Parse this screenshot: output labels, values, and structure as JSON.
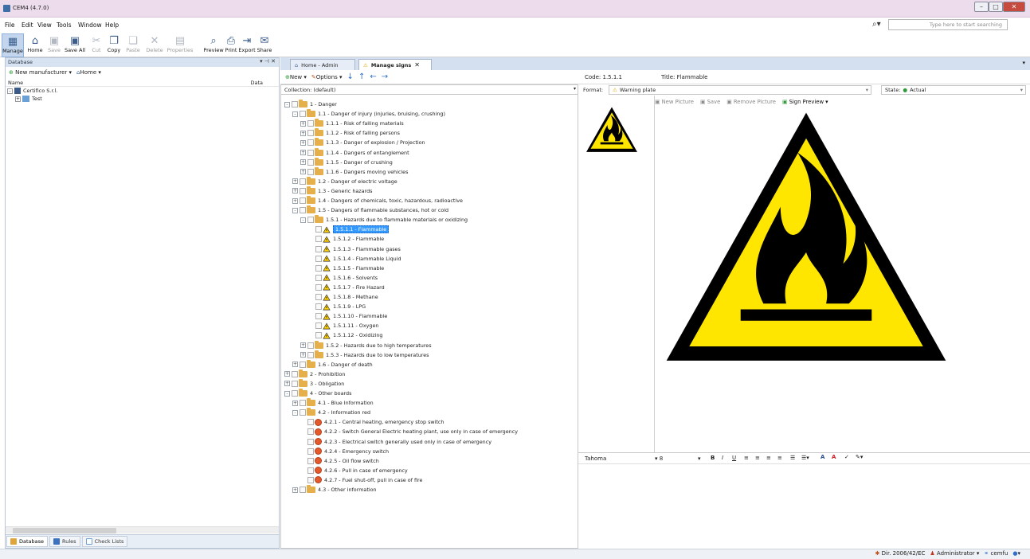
{
  "window": {
    "title": "CEM4 (4.7.0)"
  },
  "menu": [
    "File",
    "Edit",
    "View",
    "Tools",
    "Window",
    "Help"
  ],
  "search": {
    "placeholder": "Type here to start searching"
  },
  "toolbar": {
    "manage": "Manage",
    "home": "Home",
    "save": "Save",
    "save_all": "Save All",
    "cut": "Cut",
    "copy": "Copy",
    "paste": "Paste",
    "delete": "Delete",
    "properties": "Properties",
    "preview": "Preview",
    "print": "Print",
    "export": "Export",
    "share": "Share"
  },
  "left_panel": {
    "title": "Database",
    "new_manufacturer": "New manufacturer",
    "home": "Home",
    "col_name": "Name",
    "col_data": "Data",
    "tree": [
      "Certifico S.r.l.",
      "Test"
    ],
    "tabs": [
      "Database",
      "Rules",
      "Check Lists"
    ]
  },
  "tabs": [
    "Home - Admin",
    "Manage signs"
  ],
  "mid": {
    "new": "New",
    "options": "Options",
    "collection": "Collection: (default)",
    "tree": [
      {
        "label": "1 - Danger",
        "lvl": 0,
        "t": "folder",
        "pm": "-"
      },
      {
        "label": "1.1 - Danger of injury (injuries, bruising, crushing)",
        "lvl": 1,
        "t": "folder",
        "pm": "-"
      },
      {
        "label": "1.1.1 - Risk of falling materials",
        "lvl": 2,
        "t": "folder",
        "pm": "+"
      },
      {
        "label": "1.1.2 - Risk of falling persons",
        "lvl": 2,
        "t": "folder",
        "pm": "+"
      },
      {
        "label": "1.1.3 - Danger of explosion / Projection",
        "lvl": 2,
        "t": "folder",
        "pm": "+"
      },
      {
        "label": "1.1.4 - Dangers of entanglement",
        "lvl": 2,
        "t": "folder",
        "pm": "+"
      },
      {
        "label": "1.1.5 - Danger of crushing",
        "lvl": 2,
        "t": "folder",
        "pm": "+"
      },
      {
        "label": "1.1.6 - Dangers moving vehicles",
        "lvl": 2,
        "t": "folder",
        "pm": "+"
      },
      {
        "label": "1.2 - Danger of electric voltage",
        "lvl": 1,
        "t": "folder",
        "pm": "+"
      },
      {
        "label": "1.3 - Generic hazards",
        "lvl": 1,
        "t": "folder",
        "pm": "+"
      },
      {
        "label": "1.4 - Dangers of chemicals, toxic, hazardous, radioactive",
        "lvl": 1,
        "t": "folder",
        "pm": "+"
      },
      {
        "label": "1.5 - Dangers of flammable substances, hot or cold",
        "lvl": 1,
        "t": "folder",
        "pm": "-"
      },
      {
        "label": "1.5.1 - Hazards due to flammable materials or oxidizing",
        "lvl": 2,
        "t": "folder",
        "pm": "-"
      },
      {
        "label": "1.5.1.1 - Flammable",
        "lvl": 3,
        "t": "warn",
        "pm": "",
        "sel": true
      },
      {
        "label": "1.5.1.2 - Flammable",
        "lvl": 3,
        "t": "warn",
        "pm": ""
      },
      {
        "label": "1.5.1.3 - Flammable gases",
        "lvl": 3,
        "t": "warn",
        "pm": ""
      },
      {
        "label": "1.5.1.4 - Flammable Liquid",
        "lvl": 3,
        "t": "warn",
        "pm": ""
      },
      {
        "label": "1.5.1.5 - Flammable",
        "lvl": 3,
        "t": "warn",
        "pm": ""
      },
      {
        "label": "1.5.1.6 - Solvents",
        "lvl": 3,
        "t": "warn",
        "pm": ""
      },
      {
        "label": "1.5.1.7 - Fire Hazard",
        "lvl": 3,
        "t": "warn",
        "pm": ""
      },
      {
        "label": "1.5.1.8 - Methane",
        "lvl": 3,
        "t": "warn",
        "pm": ""
      },
      {
        "label": "1.5.1.9 - LPG",
        "lvl": 3,
        "t": "warn",
        "pm": ""
      },
      {
        "label": "1.5.1.10 - Flammable",
        "lvl": 3,
        "t": "warn",
        "pm": ""
      },
      {
        "label": "1.5.1.11 - Oxygen",
        "lvl": 3,
        "t": "warn",
        "pm": ""
      },
      {
        "label": "1.5.1.12 - Oxidizing",
        "lvl": 3,
        "t": "warn",
        "pm": ""
      },
      {
        "label": "1.5.2 - Hazards due to high temperatures",
        "lvl": 2,
        "t": "folder",
        "pm": "+"
      },
      {
        "label": "1.5.3 - Hazards due to low temperatures",
        "lvl": 2,
        "t": "folder",
        "pm": "+"
      },
      {
        "label": "1.6 - Danger of death",
        "lvl": 1,
        "t": "folder",
        "pm": "+"
      },
      {
        "label": "2 - Prohibition",
        "lvl": 0,
        "t": "folder",
        "pm": "+"
      },
      {
        "label": "3 - Obligation",
        "lvl": 0,
        "t": "folder",
        "pm": "+"
      },
      {
        "label": "4 - Other boards",
        "lvl": 0,
        "t": "folder",
        "pm": "-"
      },
      {
        "label": "4.1 - Blue Information",
        "lvl": 1,
        "t": "folder",
        "pm": "+"
      },
      {
        "label": "4.2 - Information red",
        "lvl": 1,
        "t": "folder",
        "pm": "-"
      },
      {
        "label": "4.2.1 - Central heating, emergency stop switch",
        "lvl": 2,
        "t": "red",
        "pm": ""
      },
      {
        "label": "4.2.2 - Switch General Electric heating plant, use only in case of emergency",
        "lvl": 2,
        "t": "red",
        "pm": ""
      },
      {
        "label": "4.2.3 - Electrical switch generally used only in case of emergency",
        "lvl": 2,
        "t": "red",
        "pm": ""
      },
      {
        "label": "4.2.4 - Emergency switch",
        "lvl": 2,
        "t": "red",
        "pm": ""
      },
      {
        "label": "4.2.5 - Oil flow switch",
        "lvl": 2,
        "t": "red",
        "pm": ""
      },
      {
        "label": "4.2.6 - Pull in case of emergency",
        "lvl": 2,
        "t": "red",
        "pm": ""
      },
      {
        "label": "4.2.7 - Fuel shut-off, pull in case of fire",
        "lvl": 2,
        "t": "red",
        "pm": ""
      },
      {
        "label": "4.3 - Other information",
        "lvl": 1,
        "t": "folder",
        "pm": "+"
      }
    ]
  },
  "detail": {
    "code": "Code: 1.5.1.1",
    "title": "Title: Flammable",
    "format_label": "Format:",
    "format_value": "Warning plate",
    "state_label": "State:",
    "state_value": "Actual",
    "pic_toolbar": [
      "New Picture",
      "Save",
      "Remove Picture",
      "Sign Preview"
    ],
    "font": "Tahoma",
    "font_size": "8"
  },
  "status": {
    "dir": "Dir. 2006/42/EC",
    "user": "Administrator",
    "db": "cemfu"
  }
}
